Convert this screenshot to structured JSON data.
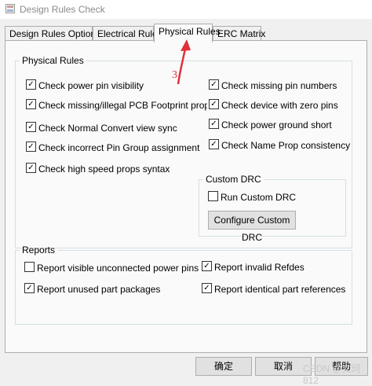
{
  "window": {
    "title": "Design Rules Check"
  },
  "tabs": [
    {
      "label": "Design Rules Options"
    },
    {
      "label": "Electrical Rules"
    },
    {
      "label": "Physical Rules"
    },
    {
      "label": "ERC Matrix"
    }
  ],
  "physical_rules": {
    "legend": "Physical Rules",
    "left": [
      {
        "label": "Check power pin visibility",
        "checked": true
      },
      {
        "label": "Check missing/illegal PCB Footprint property",
        "checked": true
      },
      {
        "label": "Check Normal Convert view sync",
        "checked": true
      },
      {
        "label": "Check incorrect Pin Group assignment",
        "checked": true
      },
      {
        "label": "Check high speed props syntax",
        "checked": true
      }
    ],
    "right": [
      {
        "label": "Check missing pin numbers",
        "checked": true
      },
      {
        "label": "Check device with zero pins",
        "checked": true
      },
      {
        "label": "Check power ground short",
        "checked": true
      },
      {
        "label": "Check Name Prop consistency",
        "checked": true
      }
    ]
  },
  "custom_drc": {
    "legend": "Custom DRC",
    "run_label": "Run Custom DRC",
    "run_checked": false,
    "configure_button": "Configure Custom DRC"
  },
  "reports": {
    "legend": "Reports",
    "items": [
      {
        "label": "Report visible unconnected power pins",
        "checked": false
      },
      {
        "label": "Report invalid Refdes",
        "checked": true
      },
      {
        "label": "Report unused part packages",
        "checked": true
      },
      {
        "label": "Report identical part references",
        "checked": true
      }
    ]
  },
  "buttons": {
    "ok": "确定",
    "cancel": "取消",
    "help": "帮助"
  },
  "annotation": {
    "number": "3",
    "color": "#e0303a"
  },
  "watermark": "CSDN @文珂812"
}
